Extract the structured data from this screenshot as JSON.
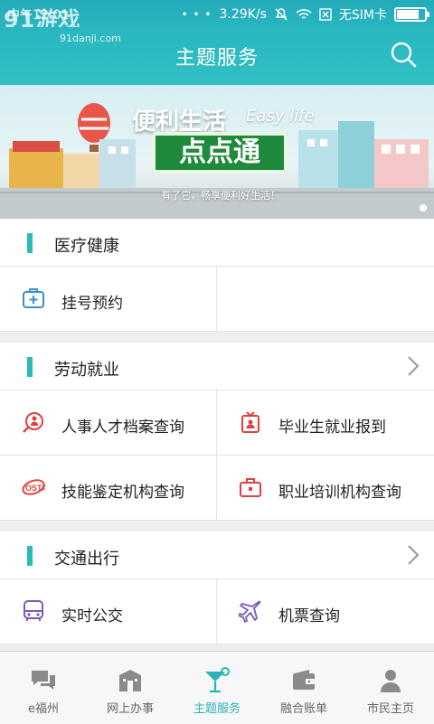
{
  "status_bar": {
    "time": "中午12:01",
    "watermark": "91游戏",
    "watermark_sub": "91danji.com",
    "net_speed": "3.29K/s",
    "sim": "无SIM卡",
    "dots": "• • •",
    "battery_level": 0.85
  },
  "header": {
    "title": "主题服务"
  },
  "banner": {
    "slogan": "便利生活",
    "slogan_en": "Easy life",
    "brand": "点点通",
    "subtitle": "有了它，畅享便利好生活！"
  },
  "sections": [
    {
      "title": "医疗健康",
      "has_more": false,
      "items": [
        {
          "label": "挂号预约",
          "icon": "medical-kit-icon"
        }
      ]
    },
    {
      "title": "劳动就业",
      "has_more": true,
      "items": [
        {
          "label": "人事人才档案查询",
          "icon": "person-search-icon"
        },
        {
          "label": "毕业生就业报到",
          "icon": "badge-icon"
        },
        {
          "label": "技能鉴定机构查询",
          "icon": "osta-icon"
        },
        {
          "label": "职业培训机构查询",
          "icon": "briefcase-icon"
        }
      ]
    },
    {
      "title": "交通出行",
      "has_more": true,
      "items": [
        {
          "label": "实时公交",
          "icon": "bus-icon"
        },
        {
          "label": "机票查询",
          "icon": "airplane-icon"
        }
      ]
    }
  ],
  "bottom_nav": [
    {
      "label": "e福州",
      "icon": "chat-icon",
      "active": false
    },
    {
      "label": "网上办事",
      "icon": "building-icon",
      "active": false
    },
    {
      "label": "主题服务",
      "icon": "cocktail-icon",
      "active": true
    },
    {
      "label": "融合账单",
      "icon": "wallet-icon",
      "active": false
    },
    {
      "label": "市民主页",
      "icon": "person-icon",
      "active": false
    }
  ],
  "colors": {
    "accent": "#2bbbb7",
    "header": "#2fbcc2",
    "red": "#e0413f",
    "purple": "#7b5bb6"
  }
}
